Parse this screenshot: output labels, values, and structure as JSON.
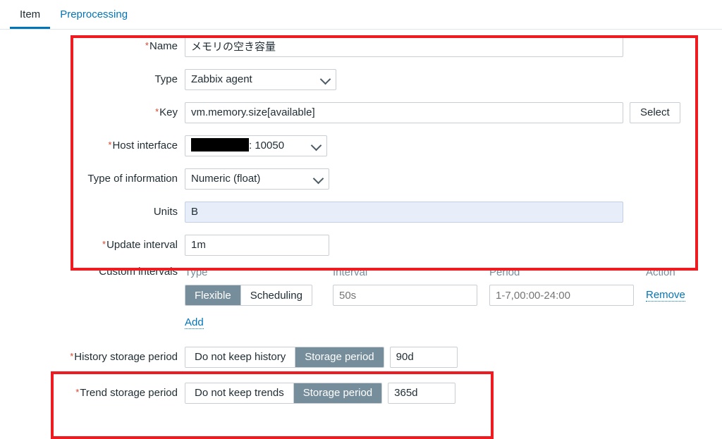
{
  "tabs": [
    {
      "label": "Item",
      "active": true
    },
    {
      "label": "Preprocessing",
      "active": false
    }
  ],
  "form": {
    "name": {
      "label": "Name",
      "required": true,
      "value": "メモリの空き容量"
    },
    "type": {
      "label": "Type",
      "required": false,
      "value": "Zabbix agent"
    },
    "key": {
      "label": "Key",
      "required": true,
      "value": "vm.memory.size[available]",
      "select_button": "Select"
    },
    "host_interface": {
      "label": "Host interface",
      "required": true,
      "value_redacted": true,
      "port_text": ": 10050"
    },
    "type_of_information": {
      "label": "Type of information",
      "required": false,
      "value": "Numeric (float)"
    },
    "units": {
      "label": "Units",
      "required": false,
      "value": "B",
      "focused": true
    },
    "update_interval": {
      "label": "Update interval",
      "required": true,
      "value": "1m"
    },
    "custom_intervals": {
      "label": "Custom intervals",
      "headers": {
        "type": "Type",
        "interval": "Interval",
        "period": "Period",
        "action": "Action"
      },
      "rows": [
        {
          "type_options": [
            "Flexible",
            "Scheduling"
          ],
          "type_selected": "Flexible",
          "interval_placeholder": "50s",
          "interval_value": "",
          "period_placeholder": "1-7,00:00-24:00",
          "period_value": "",
          "remove_label": "Remove"
        }
      ],
      "add_label": "Add"
    },
    "history_storage_period": {
      "label": "History storage period",
      "required": true,
      "options": [
        "Do not keep history",
        "Storage period"
      ],
      "selected": "Storage period",
      "value": "90d"
    },
    "trend_storage_period": {
      "label": "Trend storage period",
      "required": true,
      "options": [
        "Do not keep trends",
        "Storage period"
      ],
      "selected": "Storage period",
      "value": "365d"
    }
  },
  "annotations": {
    "accent_color": "#ee1c20",
    "boxes": [
      {
        "name": "item-main-fields-highlight"
      },
      {
        "name": "storage-period-highlight"
      }
    ]
  }
}
